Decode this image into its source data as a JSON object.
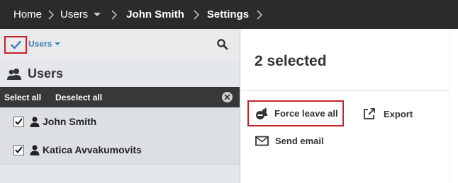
{
  "breadcrumb": {
    "items": [
      "Home",
      "Users",
      "John Smith",
      "Settings"
    ]
  },
  "toolbar": {
    "users_dropdown_label": "Users"
  },
  "panel": {
    "title": "Users"
  },
  "selection_bar": {
    "select_all": "Select all",
    "deselect_all": "Deselect all"
  },
  "users": [
    {
      "name": "John Smith",
      "checked": true
    },
    {
      "name": "Katica Avvakumovits",
      "checked": true
    }
  ],
  "details": {
    "selected_count": "2 selected",
    "actions": {
      "force_leave": "Force leave all",
      "export": "Export",
      "send_email": "Send email"
    }
  },
  "colors": {
    "topbar": "#2b2b2b",
    "highlight": "#c0262c",
    "link_blue": "#3d7ab8"
  }
}
